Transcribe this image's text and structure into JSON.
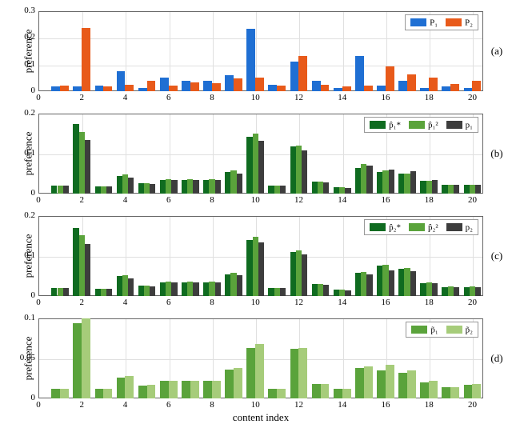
{
  "ylabel": "preference",
  "xlabel": "content index",
  "x_ticks": [
    "0",
    "2",
    "4",
    "6",
    "8",
    "10",
    "12",
    "14",
    "16",
    "18",
    "20"
  ],
  "panel_labels": {
    "a": "(a)",
    "b": "(b)",
    "c": "(c)",
    "d": "(d)"
  },
  "legends": {
    "a": {
      "s1": "P₁",
      "s2": "P₂"
    },
    "b": {
      "s1": "p̂₁*",
      "s2": "p̂₁²",
      "s3": "p₁"
    },
    "c": {
      "s1": "p̂₂*",
      "s2": "p̂₂²",
      "s3": "p₂"
    },
    "d": {
      "s1": "p̃₁",
      "s2": "p̃₂"
    }
  },
  "colors": {
    "blue": "#1f6fd3",
    "orange": "#e85a1a",
    "green_dark": "#0f6b20",
    "green_mid": "#5aa33b",
    "green_light": "#a6cc7a",
    "gray": "#3d3d3d"
  },
  "chart_data": [
    {
      "id": "a",
      "type": "bar",
      "xlabel": "",
      "ylabel": "preference",
      "ylim": [
        0,
        0.3
      ],
      "yticks": [
        0,
        0.1,
        0.2,
        0.3
      ],
      "categories": [
        1,
        2,
        3,
        4,
        5,
        6,
        7,
        8,
        9,
        10,
        11,
        12,
        13,
        14,
        15,
        16,
        17,
        18,
        19,
        20
      ],
      "series": [
        {
          "name": "P₁",
          "color": "blue",
          "values": [
            0.018,
            0.018,
            0.02,
            0.075,
            0.013,
            0.05,
            0.04,
            0.04,
            0.06,
            0.235,
            0.025,
            0.112,
            0.038,
            0.013,
            0.132,
            0.022,
            0.04,
            0.012,
            0.018,
            0.012
          ]
        },
        {
          "name": "P₂",
          "color": "orange",
          "values": [
            0.022,
            0.238,
            0.018,
            0.025,
            0.04,
            0.022,
            0.032,
            0.03,
            0.048,
            0.05,
            0.02,
            0.132,
            0.025,
            0.018,
            0.022,
            0.092,
            0.062,
            0.05,
            0.028,
            0.04
          ]
        }
      ],
      "legend_pos": {
        "right": 6,
        "top": 4
      }
    },
    {
      "id": "b",
      "type": "bar",
      "xlabel": "",
      "ylabel": "preference",
      "ylim": [
        0,
        0.2
      ],
      "yticks": [
        0,
        0.1,
        0.2
      ],
      "categories": [
        1,
        2,
        3,
        4,
        5,
        6,
        7,
        8,
        9,
        10,
        11,
        12,
        13,
        14,
        15,
        16,
        17,
        18,
        19,
        20
      ],
      "series": [
        {
          "name": "p̂₁*",
          "color": "green_dark",
          "values": [
            0.02,
            0.175,
            0.018,
            0.045,
            0.026,
            0.035,
            0.035,
            0.035,
            0.055,
            0.143,
            0.02,
            0.118,
            0.03,
            0.016,
            0.065,
            0.055,
            0.05,
            0.032,
            0.022,
            0.022
          ]
        },
        {
          "name": "p̂₁²",
          "color": "green_mid",
          "values": [
            0.02,
            0.155,
            0.018,
            0.048,
            0.027,
            0.036,
            0.036,
            0.036,
            0.058,
            0.15,
            0.02,
            0.12,
            0.03,
            0.016,
            0.075,
            0.058,
            0.05,
            0.033,
            0.023,
            0.023
          ]
        },
        {
          "name": "p₁",
          "color": "gray",
          "values": [
            0.02,
            0.135,
            0.018,
            0.04,
            0.025,
            0.034,
            0.034,
            0.034,
            0.05,
            0.133,
            0.02,
            0.108,
            0.028,
            0.015,
            0.07,
            0.06,
            0.056,
            0.034,
            0.022,
            0.022
          ]
        }
      ],
      "legend_pos": {
        "right": 6,
        "top": 4
      }
    },
    {
      "id": "c",
      "type": "bar",
      "xlabel": "",
      "ylabel": "preference",
      "ylim": [
        0,
        0.2
      ],
      "yticks": [
        0,
        0.1,
        0.2
      ],
      "categories": [
        1,
        2,
        3,
        4,
        5,
        6,
        7,
        8,
        9,
        10,
        11,
        12,
        13,
        14,
        15,
        16,
        17,
        18,
        19,
        20
      ],
      "series": [
        {
          "name": "p̂₂*",
          "color": "green_dark",
          "values": [
            0.02,
            0.17,
            0.018,
            0.05,
            0.026,
            0.035,
            0.035,
            0.035,
            0.055,
            0.14,
            0.02,
            0.11,
            0.03,
            0.016,
            0.058,
            0.076,
            0.068,
            0.032,
            0.022,
            0.022
          ]
        },
        {
          "name": "p̂₂²",
          "color": "green_mid",
          "values": [
            0.02,
            0.152,
            0.018,
            0.052,
            0.027,
            0.037,
            0.037,
            0.037,
            0.058,
            0.148,
            0.021,
            0.115,
            0.03,
            0.017,
            0.06,
            0.078,
            0.07,
            0.034,
            0.024,
            0.024
          ]
        },
        {
          "name": "p₂",
          "color": "gray",
          "values": [
            0.02,
            0.13,
            0.018,
            0.045,
            0.025,
            0.034,
            0.034,
            0.034,
            0.052,
            0.135,
            0.02,
            0.105,
            0.028,
            0.015,
            0.055,
            0.065,
            0.062,
            0.032,
            0.022,
            0.022
          ]
        }
      ],
      "legend_pos": {
        "right": 6,
        "top": 4
      }
    },
    {
      "id": "d",
      "type": "bar",
      "xlabel": "content index",
      "ylabel": "preference",
      "ylim": [
        0,
        0.1
      ],
      "yticks": [
        0,
        0.05,
        0.1
      ],
      "categories": [
        1,
        2,
        3,
        4,
        5,
        6,
        7,
        8,
        9,
        10,
        11,
        12,
        13,
        14,
        15,
        16,
        17,
        18,
        19,
        20
      ],
      "series": [
        {
          "name": "p̃₁",
          "color": "green_mid",
          "values": [
            0.012,
            0.094,
            0.012,
            0.026,
            0.016,
            0.022,
            0.022,
            0.022,
            0.036,
            0.063,
            0.012,
            0.062,
            0.018,
            0.012,
            0.038,
            0.035,
            0.032,
            0.02,
            0.014,
            0.017
          ]
        },
        {
          "name": "p̃₂",
          "color": "green_light",
          "values": [
            0.012,
            0.1,
            0.012,
            0.028,
            0.017,
            0.022,
            0.022,
            0.022,
            0.038,
            0.068,
            0.012,
            0.063,
            0.018,
            0.012,
            0.04,
            0.042,
            0.035,
            0.022,
            0.014,
            0.018
          ]
        }
      ],
      "legend_pos": {
        "right": 6,
        "top": 4
      }
    }
  ]
}
